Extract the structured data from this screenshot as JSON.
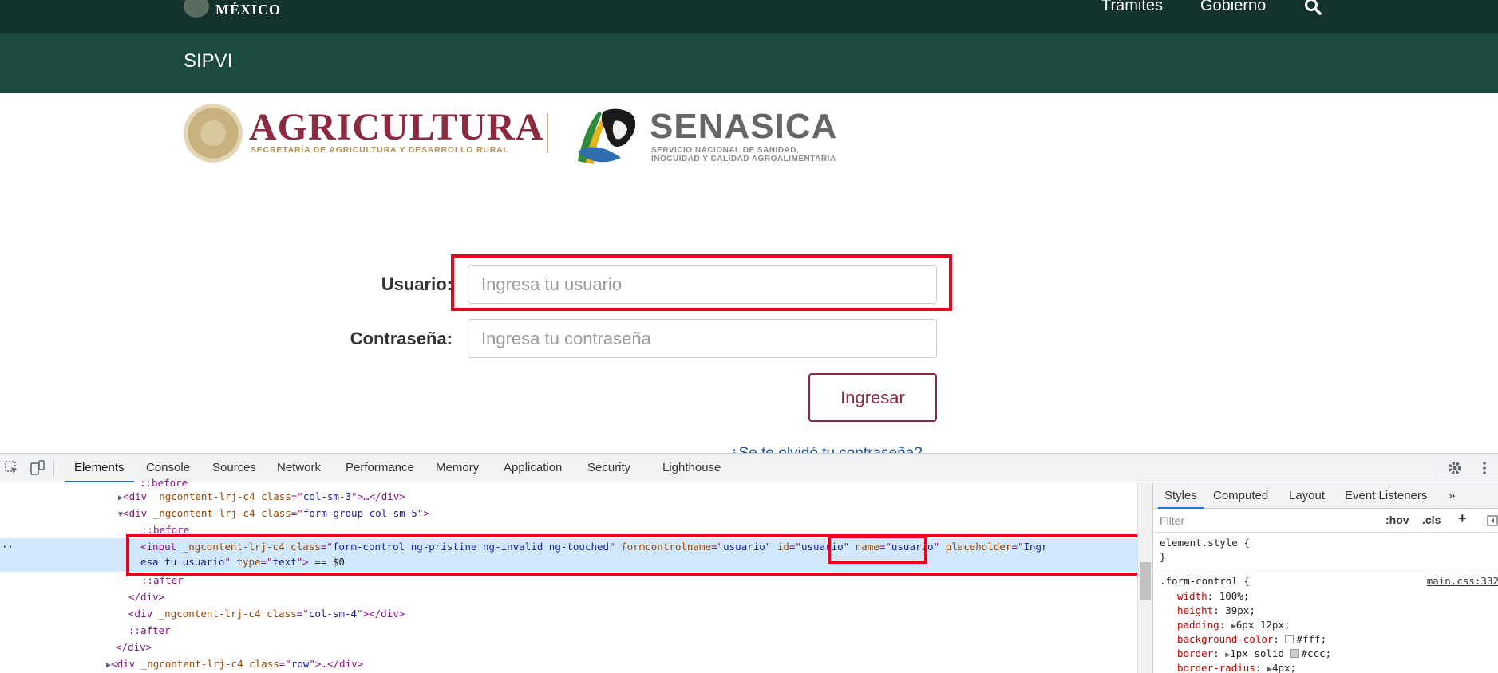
{
  "gov_header": {
    "country": "MÉXICO",
    "nav": [
      {
        "label": "Trámites"
      },
      {
        "label": "Gobierno"
      }
    ]
  },
  "sub_header": {
    "title": "SIPVI"
  },
  "logos": {
    "agricultura": {
      "name": "AGRICULTURA",
      "subtitle": "SECRETARÍA DE AGRICULTURA Y DESARROLLO RURAL"
    },
    "senasica": {
      "name": "SENASICA",
      "subtitle_line1": "SERVICIO NACIONAL DE SANIDAD,",
      "subtitle_line2": "INOCUIDAD Y CALIDAD AGROALIMENTARIA"
    }
  },
  "login_form": {
    "user_label": "Usuario:",
    "user_placeholder": "Ingresa tu usuario",
    "password_label": "Contraseña:",
    "password_placeholder": "Ingresa tu contraseña",
    "submit_label": "Ingresar",
    "forgot_link": "¿Se te olvidó tu contraseña?"
  },
  "devtools": {
    "tabs": [
      "Elements",
      "Console",
      "Sources",
      "Network",
      "Performance",
      "Memory",
      "Application",
      "Security",
      "Lighthouse"
    ],
    "active_tab": "Elements",
    "dom": {
      "l0": "::before",
      "l1_tag": "div",
      "l1_attr": "_ngcontent-lrj-c4",
      "l1_class_attr": "class",
      "l1_class": "col-sm-3",
      "l1_tail": ">…</div>",
      "l2_tag": "div",
      "l2_attr": "_ngcontent-lrj-c4",
      "l2_class_attr": "class",
      "l2_class": "form-group col-sm-5",
      "l3": "::before",
      "sel_tag": "input",
      "sel_attr": "_ngcontent-lrj-c4",
      "sel_class_attr": "class",
      "sel_class": "form-control ng-pristine ng-invalid ng-touched",
      "sel_fcn_attr": "formcontrolname",
      "sel_fcn": "usuario",
      "sel_id_attr": "id",
      "sel_id": "usuario",
      "sel_name_attr": "name",
      "sel_name": "usuario",
      "sel_ph_attr": "placeholder",
      "sel_ph_start": "Ingr",
      "sel_ph_end": "esa tu usuario",
      "sel_type_attr": "type",
      "sel_type": "text",
      "sel_tail": "== $0",
      "l5": "::after",
      "l6": "</div>",
      "l7_tag": "div",
      "l7_attr": "_ngcontent-lrj-c4",
      "l7_class_attr": "class",
      "l7_class": "col-sm-4",
      "l7_tail": "></div>",
      "l8": "::after",
      "l9": "</div>",
      "l10_tag": "div",
      "l10_attr": "_ngcontent-lrj-c4",
      "l10_class_attr": "class",
      "l10_class": "row",
      "l10_tail": ">…</div>"
    },
    "styles": {
      "tabs": [
        "Styles",
        "Computed",
        "Layout",
        "Event Listeners"
      ],
      "more": "»",
      "filter_placeholder": "Filter",
      "hov": ":hov",
      "cls": ".cls",
      "plus": "+",
      "element_style_open": "element.style {",
      "element_style_close": "}",
      "rule_selector": ".form-control {",
      "rule_source": "main.css:332",
      "props": [
        {
          "name": "width",
          "value": "100%;"
        },
        {
          "name": "height",
          "value": "39px;"
        },
        {
          "name": "padding",
          "value": "6px 12px;"
        },
        {
          "name": "background-color",
          "value": "#fff;"
        },
        {
          "name": "border",
          "value": "1px solid #ccc;"
        },
        {
          "name": "border-radius",
          "value": "4px;"
        }
      ]
    }
  },
  "colors": {
    "gov_bar": "#13322b",
    "sub_bar": "#1d4a40",
    "brand_maroon": "#8c2b3f",
    "highlight": "#e8001c"
  }
}
